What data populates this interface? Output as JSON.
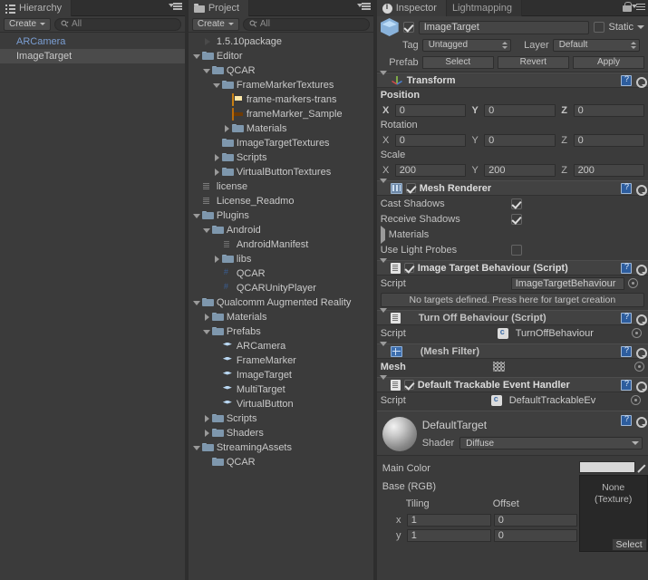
{
  "hierarchy": {
    "tab_label": "Hierarchy",
    "create_label": "Create",
    "search_placeholder": "All",
    "items": [
      {
        "label": "ARCamera",
        "selected": false,
        "blue": true
      },
      {
        "label": "ImageTarget",
        "selected": true,
        "blue": false
      }
    ]
  },
  "project": {
    "tab_label": "Project",
    "create_label": "Create",
    "search_placeholder": "All",
    "items": [
      {
        "label": "1.5.10package",
        "indent": 0,
        "arrow": "none",
        "icon": "unity-package-icon"
      },
      {
        "label": "Editor",
        "indent": 0,
        "arrow": "down",
        "icon": "folder-icon"
      },
      {
        "label": "QCAR",
        "indent": 1,
        "arrow": "down",
        "icon": "folder-icon"
      },
      {
        "label": "FrameMarkerTextures",
        "indent": 2,
        "arrow": "down",
        "icon": "folder-icon"
      },
      {
        "label": "frame-markers-trans",
        "indent": 3,
        "arrow": "none",
        "icon": "texture-icon-a"
      },
      {
        "label": "frameMarker_Sample",
        "indent": 3,
        "arrow": "none",
        "icon": "texture-icon-b"
      },
      {
        "label": "Materials",
        "indent": 3,
        "arrow": "right",
        "icon": "folder-icon"
      },
      {
        "label": "ImageTargetTextures",
        "indent": 2,
        "arrow": "none",
        "icon": "folder-icon"
      },
      {
        "label": "Scripts",
        "indent": 2,
        "arrow": "right",
        "icon": "folder-icon"
      },
      {
        "label": "VirtualButtonTextures",
        "indent": 2,
        "arrow": "right",
        "icon": "folder-icon"
      },
      {
        "label": "license",
        "indent": 0,
        "arrow": "none",
        "icon": "document-icon"
      },
      {
        "label": "License_Readmo",
        "indent": 0,
        "arrow": "none",
        "icon": "document-icon"
      },
      {
        "label": "Plugins",
        "indent": 0,
        "arrow": "down",
        "icon": "folder-icon"
      },
      {
        "label": "Android",
        "indent": 1,
        "arrow": "down",
        "icon": "folder-icon"
      },
      {
        "label": "AndroidManifest",
        "indent": 2,
        "arrow": "none",
        "icon": "text-file-icon"
      },
      {
        "label": "libs",
        "indent": 2,
        "arrow": "right",
        "icon": "folder-icon"
      },
      {
        "label": "QCAR",
        "indent": 2,
        "arrow": "none",
        "icon": "dll-icon"
      },
      {
        "label": "QCARUnityPlayer",
        "indent": 2,
        "arrow": "none",
        "icon": "dll-icon"
      },
      {
        "label": "Qualcomm Augmented Reality",
        "indent": 0,
        "arrow": "down",
        "icon": "folder-icon"
      },
      {
        "label": "Materials",
        "indent": 1,
        "arrow": "right",
        "icon": "folder-icon"
      },
      {
        "label": "Prefabs",
        "indent": 1,
        "arrow": "down",
        "icon": "folder-icon"
      },
      {
        "label": "ARCamera",
        "indent": 2,
        "arrow": "none",
        "icon": "prefab-icon"
      },
      {
        "label": "FrameMarker",
        "indent": 2,
        "arrow": "none",
        "icon": "prefab-icon"
      },
      {
        "label": "ImageTarget",
        "indent": 2,
        "arrow": "none",
        "icon": "prefab-icon"
      },
      {
        "label": "MultiTarget",
        "indent": 2,
        "arrow": "none",
        "icon": "prefab-icon"
      },
      {
        "label": "VirtualButton",
        "indent": 2,
        "arrow": "none",
        "icon": "prefab-icon"
      },
      {
        "label": "Scripts",
        "indent": 1,
        "arrow": "right",
        "icon": "folder-icon"
      },
      {
        "label": "Shaders",
        "indent": 1,
        "arrow": "right",
        "icon": "folder-icon"
      },
      {
        "label": "StreamingAssets",
        "indent": 0,
        "arrow": "down",
        "icon": "folder-icon"
      },
      {
        "label": "QCAR",
        "indent": 1,
        "arrow": "none",
        "icon": "folder-icon"
      }
    ]
  },
  "inspector": {
    "tab_label": "Inspector",
    "tab2_label": "Lightmapping",
    "object": {
      "name": "ImageTarget",
      "enabled": true,
      "static_label": "Static",
      "static_checked": false,
      "tag_label": "Tag",
      "tag_value": "Untagged",
      "layer_label": "Layer",
      "layer_value": "Default",
      "prefab_label": "Prefab",
      "prefab_select": "Select",
      "prefab_revert": "Revert",
      "prefab_apply": "Apply"
    },
    "transform": {
      "title": "Transform",
      "position_label": "Position",
      "rotation_label": "Rotation",
      "scale_label": "Scale",
      "axis": [
        "X",
        "Y",
        "Z"
      ],
      "position": [
        "0",
        "0",
        "0"
      ],
      "rotation": [
        "0",
        "0",
        "0"
      ],
      "scale": [
        "200",
        "200",
        "200"
      ]
    },
    "mesh_renderer": {
      "title": "Mesh Renderer",
      "enabled": true,
      "cast_shadows_label": "Cast Shadows",
      "cast_shadows": true,
      "receive_shadows_label": "Receive Shadows",
      "receive_shadows": true,
      "materials_label": "Materials",
      "light_probes_label": "Use Light Probes",
      "light_probes": false
    },
    "image_target_behaviour": {
      "title": "Image Target Behaviour (Script)",
      "enabled": true,
      "script_label": "Script",
      "script_value": "ImageTargetBehaviour",
      "help_text": "No targets defined. Press here for target creation"
    },
    "turn_off_behaviour": {
      "title": "Turn Off Behaviour (Script)",
      "script_label": "Script",
      "script_value": "TurnOffBehaviour"
    },
    "mesh_filter": {
      "title": "(Mesh Filter)",
      "mesh_label": "Mesh",
      "mesh_value": ""
    },
    "default_trackable": {
      "title": "Default Trackable Event Handler",
      "enabled": true,
      "script_label": "Script",
      "script_value": "DefaultTrackableEv"
    },
    "material": {
      "name": "DefaultTarget",
      "shader_label": "Shader",
      "shader_value": "Diffuse",
      "main_color_label": "Main Color",
      "base_rgb_label": "Base (RGB)",
      "main_color_hex": "#d8d8d8",
      "texture_none_line1": "None",
      "texture_none_line2": "(Texture)",
      "texture_select_label": "Select",
      "tiling_label": "Tiling",
      "offset_label": "Offset",
      "rows": [
        {
          "axis": "x",
          "tiling": "1",
          "offset": "0"
        },
        {
          "axis": "y",
          "tiling": "1",
          "offset": "0"
        }
      ]
    }
  }
}
